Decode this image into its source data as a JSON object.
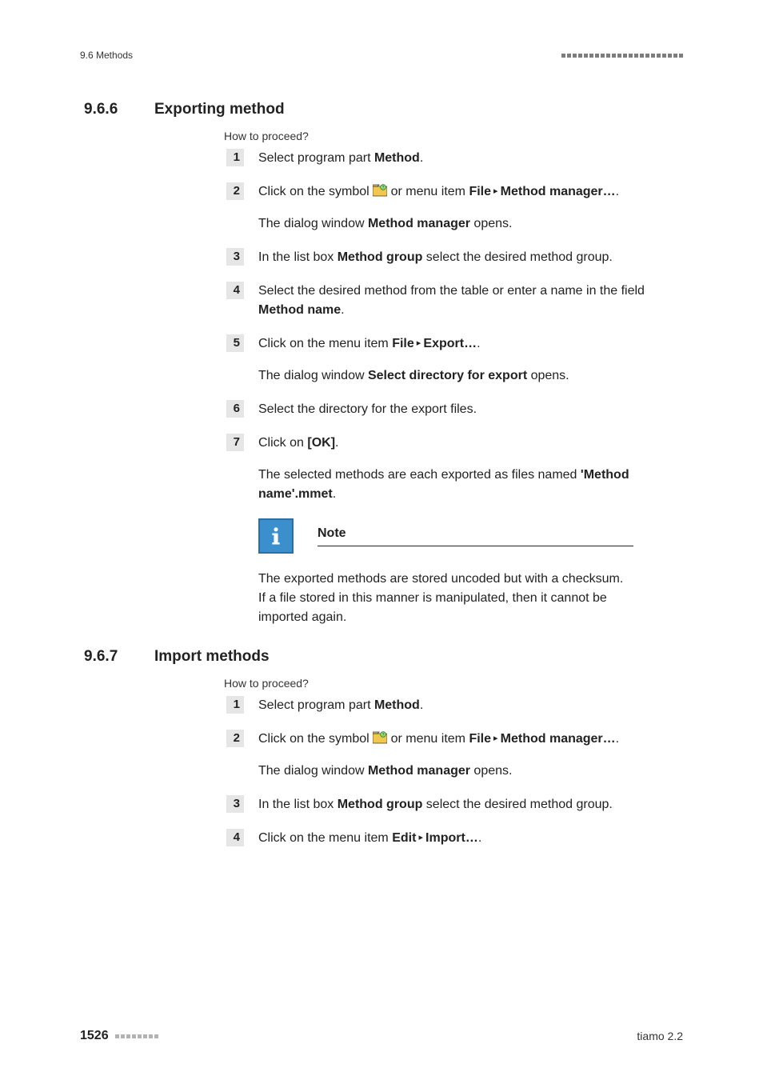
{
  "header": {
    "left": "9.6 Methods"
  },
  "sections": [
    {
      "number": "9.6.6",
      "title": "Exporting method",
      "intro": "How to proceed?",
      "steps": [
        {
          "n": "1",
          "parts": [
            {
              "t": "Select program part "
            },
            {
              "t": "Method",
              "b": true
            },
            {
              "t": "."
            }
          ]
        },
        {
          "n": "2",
          "parts": [
            {
              "t": "Click on the symbol "
            },
            {
              "icon": "folder"
            },
            {
              "t": " or menu item "
            },
            {
              "t": "File",
              "b": true
            },
            {
              "tri": true
            },
            {
              "t": "Method manager…",
              "b": true
            },
            {
              "t": "."
            }
          ],
          "sub": [
            {
              "t": "The dialog window "
            },
            {
              "t": "Method manager",
              "b": true
            },
            {
              "t": " opens."
            }
          ]
        },
        {
          "n": "3",
          "parts": [
            {
              "t": "In the list box "
            },
            {
              "t": "Method group",
              "b": true
            },
            {
              "t": " select the desired method group."
            }
          ]
        },
        {
          "n": "4",
          "parts": [
            {
              "t": "Select the desired method from the table or enter a name in the field "
            },
            {
              "t": "Method name",
              "b": true
            },
            {
              "t": "."
            }
          ]
        },
        {
          "n": "5",
          "parts": [
            {
              "t": "Click on the menu item "
            },
            {
              "t": "File",
              "b": true
            },
            {
              "tri": true
            },
            {
              "t": "Export…",
              "b": true
            },
            {
              "t": "."
            }
          ],
          "sub": [
            {
              "t": "The dialog window "
            },
            {
              "t": "Select directory for export",
              "b": true
            },
            {
              "t": " opens."
            }
          ]
        },
        {
          "n": "6",
          "parts": [
            {
              "t": "Select the directory for the export files."
            }
          ]
        },
        {
          "n": "7",
          "parts": [
            {
              "t": "Click on "
            },
            {
              "t": "[OK]",
              "b": true
            },
            {
              "t": "."
            }
          ],
          "sub": [
            {
              "t": "The selected methods are each exported as files named "
            },
            {
              "t": "'Method name'.mmet",
              "b": true
            },
            {
              "t": "."
            }
          ]
        }
      ],
      "note": {
        "title": "Note",
        "body": "The exported methods are stored uncoded but with a checksum. If a file stored in this manner is manipulated, then it cannot be imported again."
      }
    },
    {
      "number": "9.6.7",
      "title": "Import methods",
      "intro": "How to proceed?",
      "steps": [
        {
          "n": "1",
          "parts": [
            {
              "t": "Select program part "
            },
            {
              "t": "Method",
              "b": true
            },
            {
              "t": "."
            }
          ]
        },
        {
          "n": "2",
          "parts": [
            {
              "t": "Click on the symbol "
            },
            {
              "icon": "folder"
            },
            {
              "t": " or menu item "
            },
            {
              "t": "File",
              "b": true
            },
            {
              "tri": true
            },
            {
              "t": "Method manager…",
              "b": true
            },
            {
              "t": "."
            }
          ],
          "sub": [
            {
              "t": "The dialog window "
            },
            {
              "t": "Method manager",
              "b": true
            },
            {
              "t": " opens."
            }
          ]
        },
        {
          "n": "3",
          "parts": [
            {
              "t": "In the list box "
            },
            {
              "t": "Method group",
              "b": true
            },
            {
              "t": " select the desired method group."
            }
          ]
        },
        {
          "n": "4",
          "parts": [
            {
              "t": "Click on the menu item "
            },
            {
              "t": "Edit",
              "b": true
            },
            {
              "tri": true
            },
            {
              "t": "Import…",
              "b": true
            },
            {
              "t": "."
            }
          ]
        }
      ]
    }
  ],
  "footer": {
    "page": "1526",
    "right": "tiamo 2.2"
  }
}
